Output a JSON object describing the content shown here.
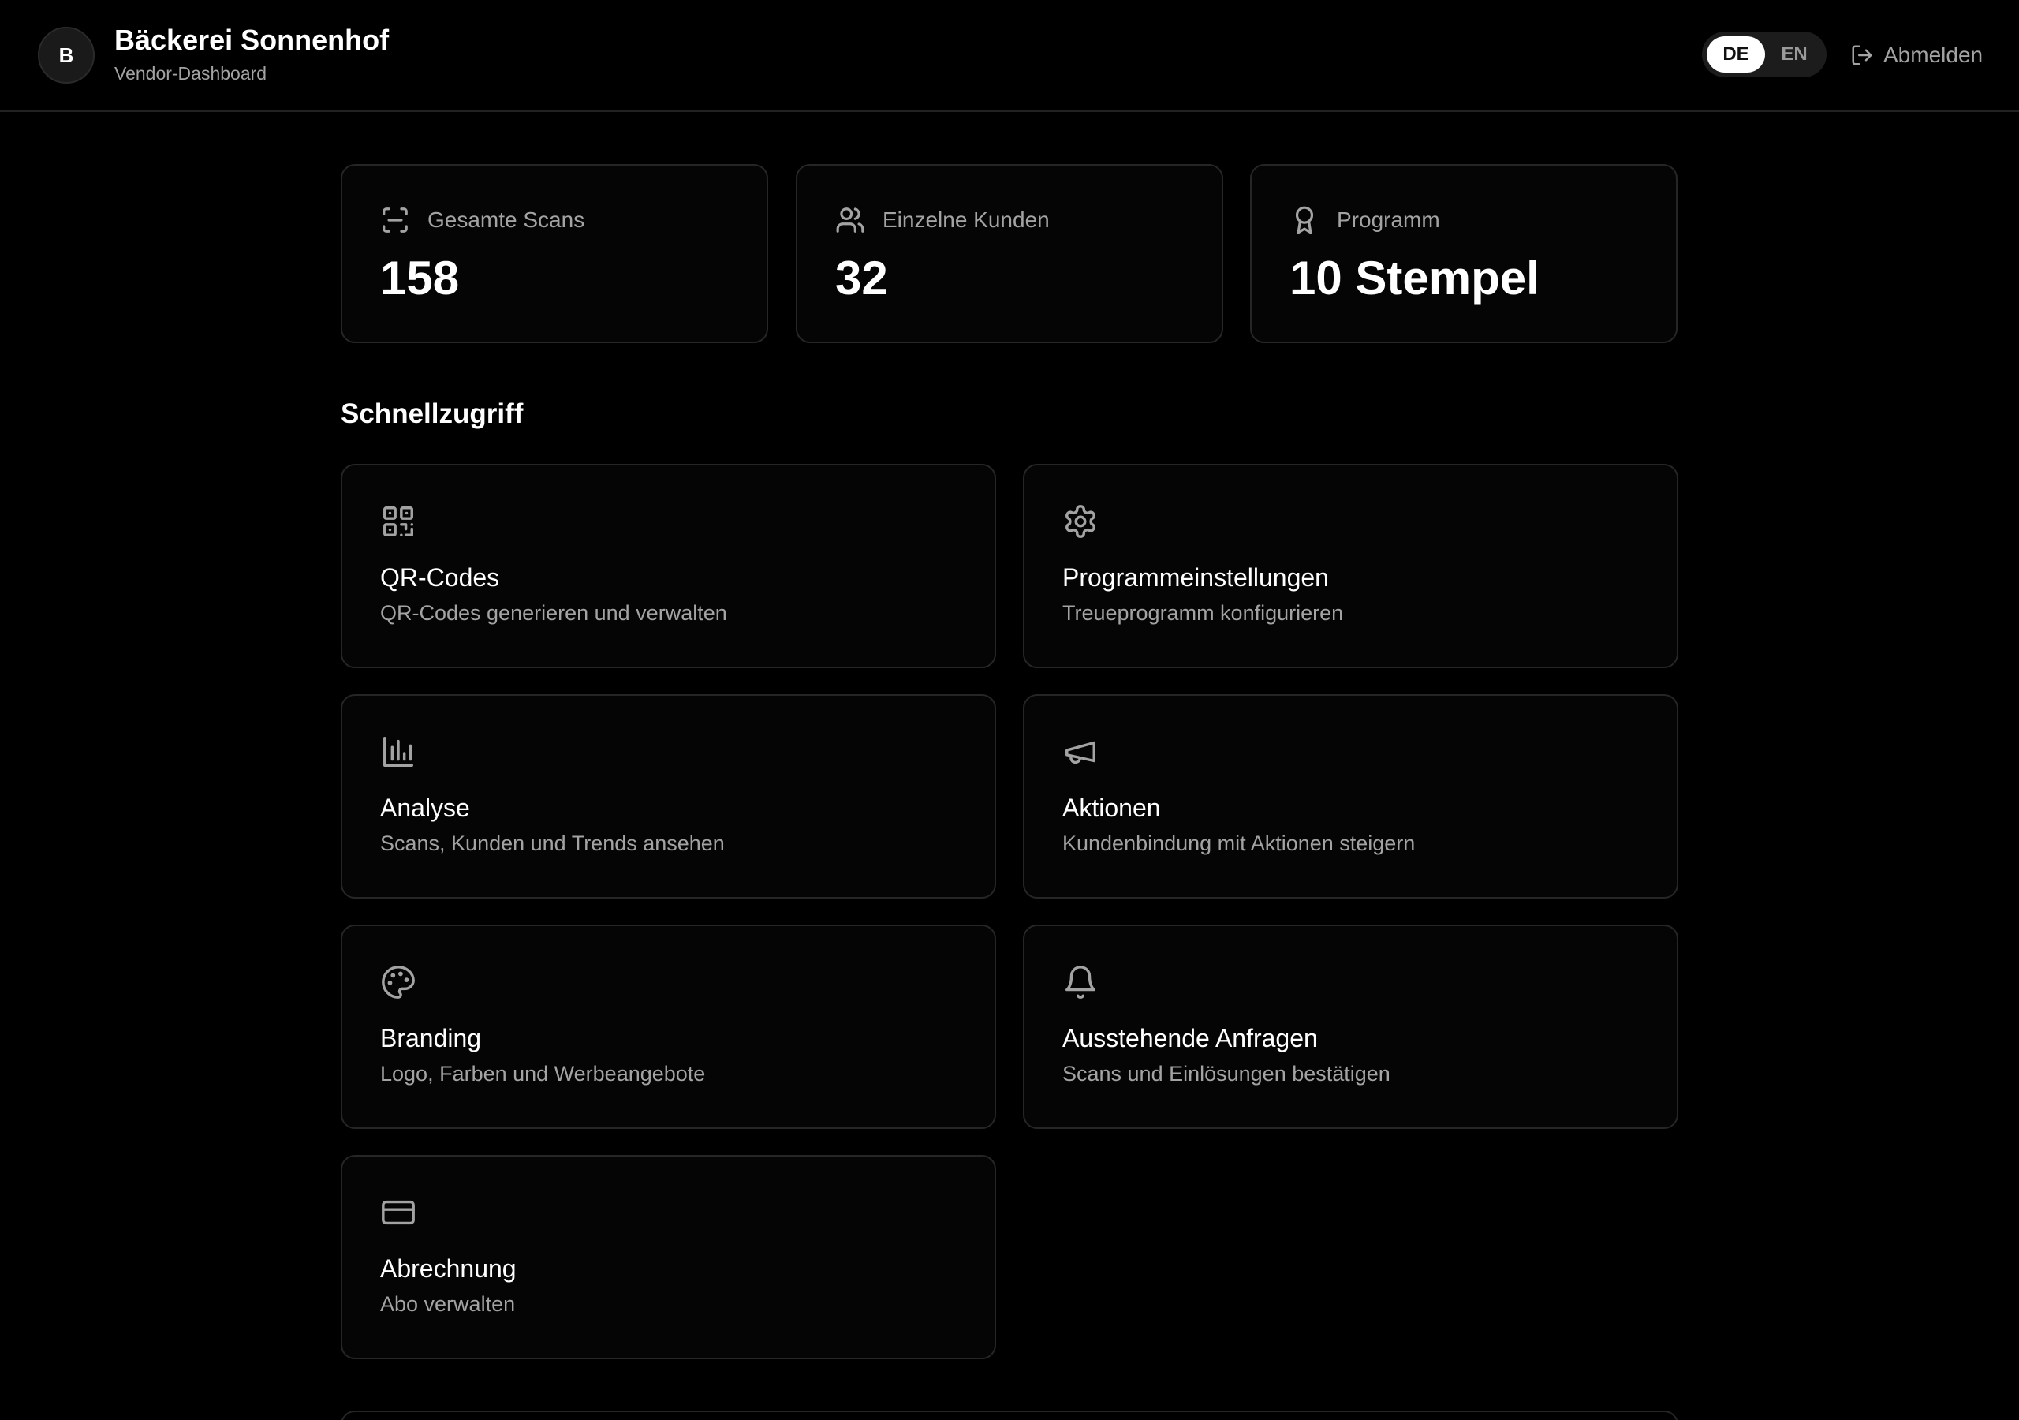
{
  "header": {
    "avatar_letter": "B",
    "business_name": "Bäckerei Sonnenhof",
    "subtitle": "Vendor-Dashboard",
    "languages": [
      {
        "label": "DE",
        "active": true
      },
      {
        "label": "EN",
        "active": false
      }
    ],
    "logout_label": "Abmelden",
    "logout_icon": "logout-icon"
  },
  "stats": [
    {
      "label": "Gesamte Scans",
      "value": "158",
      "icon": "scan-icon"
    },
    {
      "label": "Einzelne Kunden",
      "value": "32",
      "icon": "users-icon"
    },
    {
      "label": "Programm",
      "value": "10 Stempel",
      "icon": "award-icon"
    }
  ],
  "quick_access": {
    "title": "Schnellzugriff",
    "tiles": [
      {
        "title": "QR-Codes",
        "description": "QR-Codes generieren und verwalten",
        "icon": "qr-code-icon"
      },
      {
        "title": "Programmeinstellungen",
        "description": "Treueprogramm konfigurieren",
        "icon": "gear-icon"
      },
      {
        "title": "Analyse",
        "description": "Scans, Kunden und Trends ansehen",
        "icon": "bar-chart-icon"
      },
      {
        "title": "Aktionen",
        "description": "Kundenbindung mit Aktionen steigern",
        "icon": "megaphone-icon"
      },
      {
        "title": "Branding",
        "description": "Logo, Farben und Werbeangebote",
        "icon": "palette-icon"
      },
      {
        "title": "Ausstehende Anfragen",
        "description": "Scans und Einlösungen bestätigen",
        "icon": "bell-icon"
      },
      {
        "title": "Abrechnung",
        "description": "Abo verwalten",
        "icon": "credit-card-icon"
      }
    ]
  },
  "colors": {
    "background": "#000000",
    "card_border": "#262626",
    "muted_text": "#a3a3a3",
    "active_toggle": "#ffffff"
  }
}
